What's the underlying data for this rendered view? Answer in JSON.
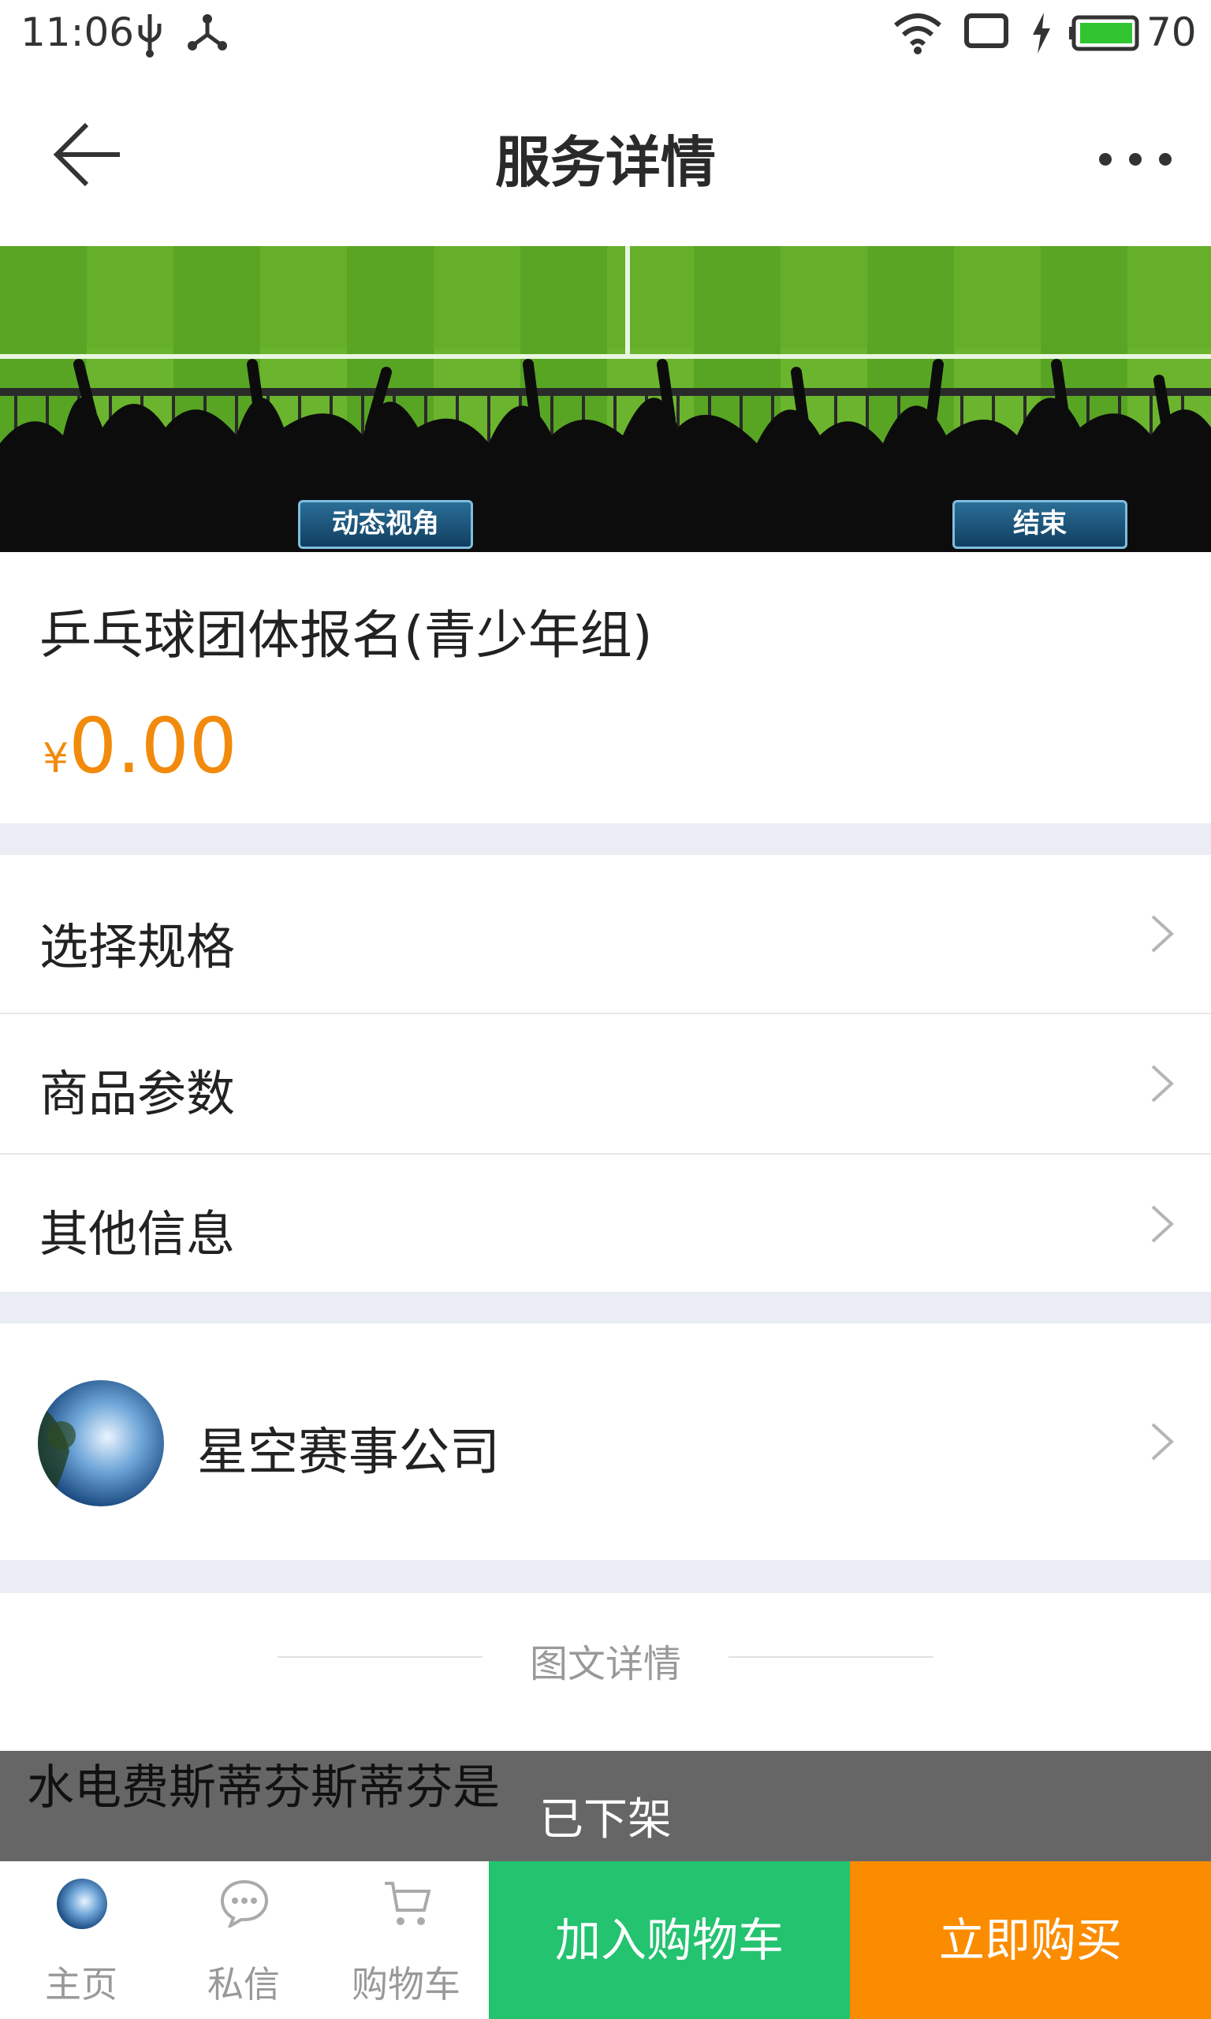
{
  "status_bar": {
    "time": "11:06",
    "battery": "70",
    "icons": [
      "usb-icon",
      "share-node-icon",
      "wifi-icon",
      "tablet-icon",
      "charging-icon",
      "battery-icon"
    ]
  },
  "header": {
    "title": "服务详情",
    "back_icon": "arrow-left-icon",
    "more_icon": "more-dots-icon"
  },
  "banner": {
    "left_button": "动态视角",
    "right_button": "结束"
  },
  "product": {
    "title": "乒乓球团体报名(青少年组)",
    "currency": "¥",
    "price": "0.00"
  },
  "menu": {
    "items": [
      {
        "label": "选择规格"
      },
      {
        "label": "商品参数"
      },
      {
        "label": "其他信息"
      }
    ]
  },
  "shop": {
    "name": "星空赛事公司"
  },
  "details": {
    "title": "图文详情",
    "description": "水电费斯蒂芬斯蒂芬是",
    "status": "已下架"
  },
  "bottom_nav": {
    "home": "主页",
    "messages": "私信",
    "cart": "购物车",
    "add_to_cart": "加入购物车",
    "buy_now": "立即购买"
  },
  "colors": {
    "price": "#f28a0c",
    "add_to_cart_bg": "#23c370",
    "buy_now_bg": "#fb8c00",
    "section_gap": "#eaedf3"
  }
}
